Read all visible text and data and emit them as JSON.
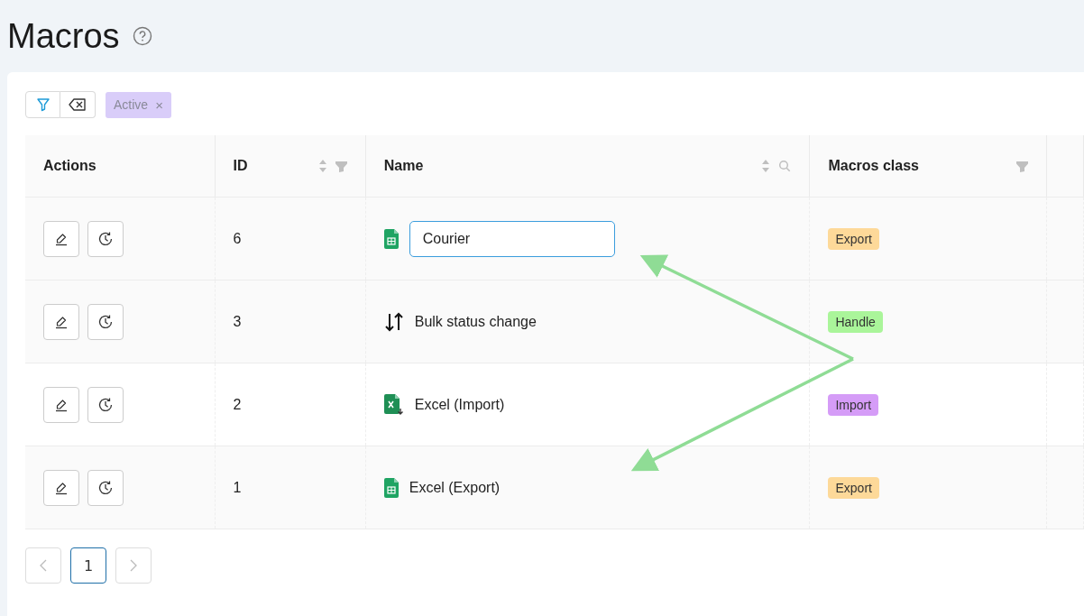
{
  "page": {
    "title": "Macros"
  },
  "filter_tags": [
    {
      "label": "Active",
      "remove": "×"
    }
  ],
  "table": {
    "columns": [
      {
        "label": "Actions",
        "sortable": false,
        "filter": false,
        "search": false
      },
      {
        "label": "ID",
        "sortable": true,
        "filter": true,
        "search": false
      },
      {
        "label": "Name",
        "sortable": true,
        "filter": false,
        "search": true
      },
      {
        "label": "Macros class",
        "sortable": false,
        "filter": true,
        "search": false
      }
    ],
    "rows": [
      {
        "id": "6",
        "kind": "sheet",
        "name": "Courier",
        "editing": true,
        "class": {
          "label": "Export",
          "color": "#fdd999"
        }
      },
      {
        "id": "3",
        "kind": "sort",
        "name": "Bulk status change",
        "editing": false,
        "class": {
          "label": "Handle",
          "color": "#aaf59a"
        }
      },
      {
        "id": "2",
        "kind": "excel",
        "name": "Excel (Import)",
        "editing": false,
        "class": {
          "label": "Import",
          "color": "#d59cf7"
        }
      },
      {
        "id": "1",
        "kind": "sheet",
        "name": "Excel (Export)",
        "editing": false,
        "class": {
          "label": "Export",
          "color": "#fdd999"
        }
      }
    ]
  },
  "pagination": {
    "pages": [
      {
        "label": "1",
        "selected": true
      }
    ]
  }
}
